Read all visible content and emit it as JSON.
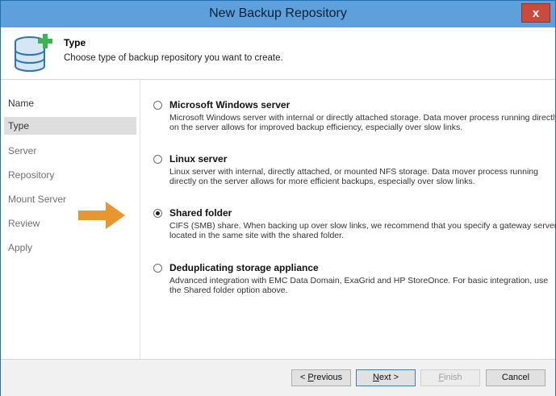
{
  "window": {
    "title": "New Backup Repository",
    "close_label": "x"
  },
  "header": {
    "title": "Type",
    "description": "Choose type of backup repository you want to create."
  },
  "nav": {
    "items": [
      {
        "label": "Name",
        "active": false
      },
      {
        "label": "Type",
        "active": true
      },
      {
        "label": "Server",
        "active": false
      },
      {
        "label": "Repository",
        "active": false
      },
      {
        "label": "Mount Server",
        "active": false
      },
      {
        "label": "Review",
        "active": false
      },
      {
        "label": "Apply",
        "active": false
      }
    ]
  },
  "options": [
    {
      "title": "Microsoft Windows server",
      "description": "Microsoft Windows server with internal or directly attached storage. Data mover process running directly on the server allows for improved backup efficiency, especially over slow links.",
      "selected": false
    },
    {
      "title": "Linux server",
      "description": "Linux server with internal, directly attached, or mounted NFS storage. Data mover process running directly on the server allows for more efficient backups, especially over slow links.",
      "selected": false
    },
    {
      "title": "Shared folder",
      "description": "CIFS (SMB) share. When backing up over slow links, we recommend that you specify a gateway server located in the same site with the shared folder.",
      "selected": true
    },
    {
      "title": "Deduplicating storage appliance",
      "description": "Advanced integration with EMC Data Domain, ExaGrid and HP StoreOnce. For basic integration, use the Shared folder option above.",
      "selected": false
    }
  ],
  "footer": {
    "previous": {
      "pre": "< ",
      "key": "P",
      "post": "revious"
    },
    "next": {
      "key": "N",
      "post": "ext >"
    },
    "finish": {
      "key": "F",
      "post": "inish"
    },
    "cancel": "Cancel"
  },
  "colors": {
    "titlebar": "#5ea0db",
    "close": "#c94b3c",
    "arrow": "#e8962e",
    "db_icon": "#2f75b5",
    "plus": "#3fb34f"
  },
  "icons": {
    "header": "database-add-icon",
    "pointer": "arrow-right-icon"
  }
}
